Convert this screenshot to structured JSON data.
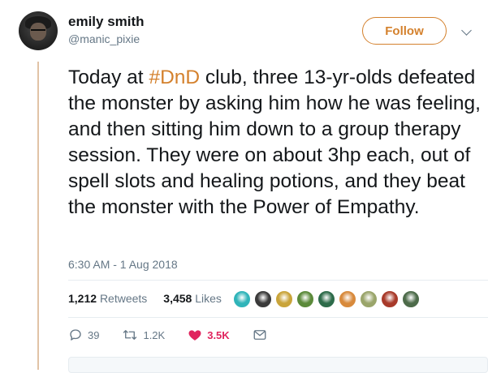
{
  "user": {
    "display_name": "emily smith",
    "handle": "@manic_pixie",
    "follow_label": "Follow"
  },
  "tweet": {
    "text_before": "Today at ",
    "hashtag": "#DnD",
    "text_after": " club, three 13-yr-olds defeated the monster by asking him how he was feeling, and then sitting him down to a group therapy session. They were on about 3hp each, out of spell slots and healing potions, and they beat the monster with the Power of Empathy.",
    "timestamp": "6:30 AM - 1 Aug 2018"
  },
  "stats": {
    "retweets_count": "1,212",
    "retweets_label": "Retweets",
    "likes_count": "3,458",
    "likes_label": "Likes"
  },
  "liker_avatars": [
    {
      "name": "liker-avatar-1",
      "color": "#2fb4b9"
    },
    {
      "name": "liker-avatar-2",
      "color": "#3a3a3a"
    },
    {
      "name": "liker-avatar-3",
      "color": "#c9a43a"
    },
    {
      "name": "liker-avatar-4",
      "color": "#5b8a3a"
    },
    {
      "name": "liker-avatar-5",
      "color": "#2d6b4a"
    },
    {
      "name": "liker-avatar-6",
      "color": "#d88a3c"
    },
    {
      "name": "liker-avatar-7",
      "color": "#9aa56b"
    },
    {
      "name": "liker-avatar-8",
      "color": "#a83a2a"
    },
    {
      "name": "liker-avatar-9",
      "color": "#4d6b4a"
    }
  ],
  "actions": {
    "replies": "39",
    "retweets": "1.2K",
    "likes": "3.5K"
  },
  "colors": {
    "accent": "#d4812d",
    "like": "#e0245e",
    "muted": "#657786",
    "thread_line": "#e1c3a6"
  }
}
